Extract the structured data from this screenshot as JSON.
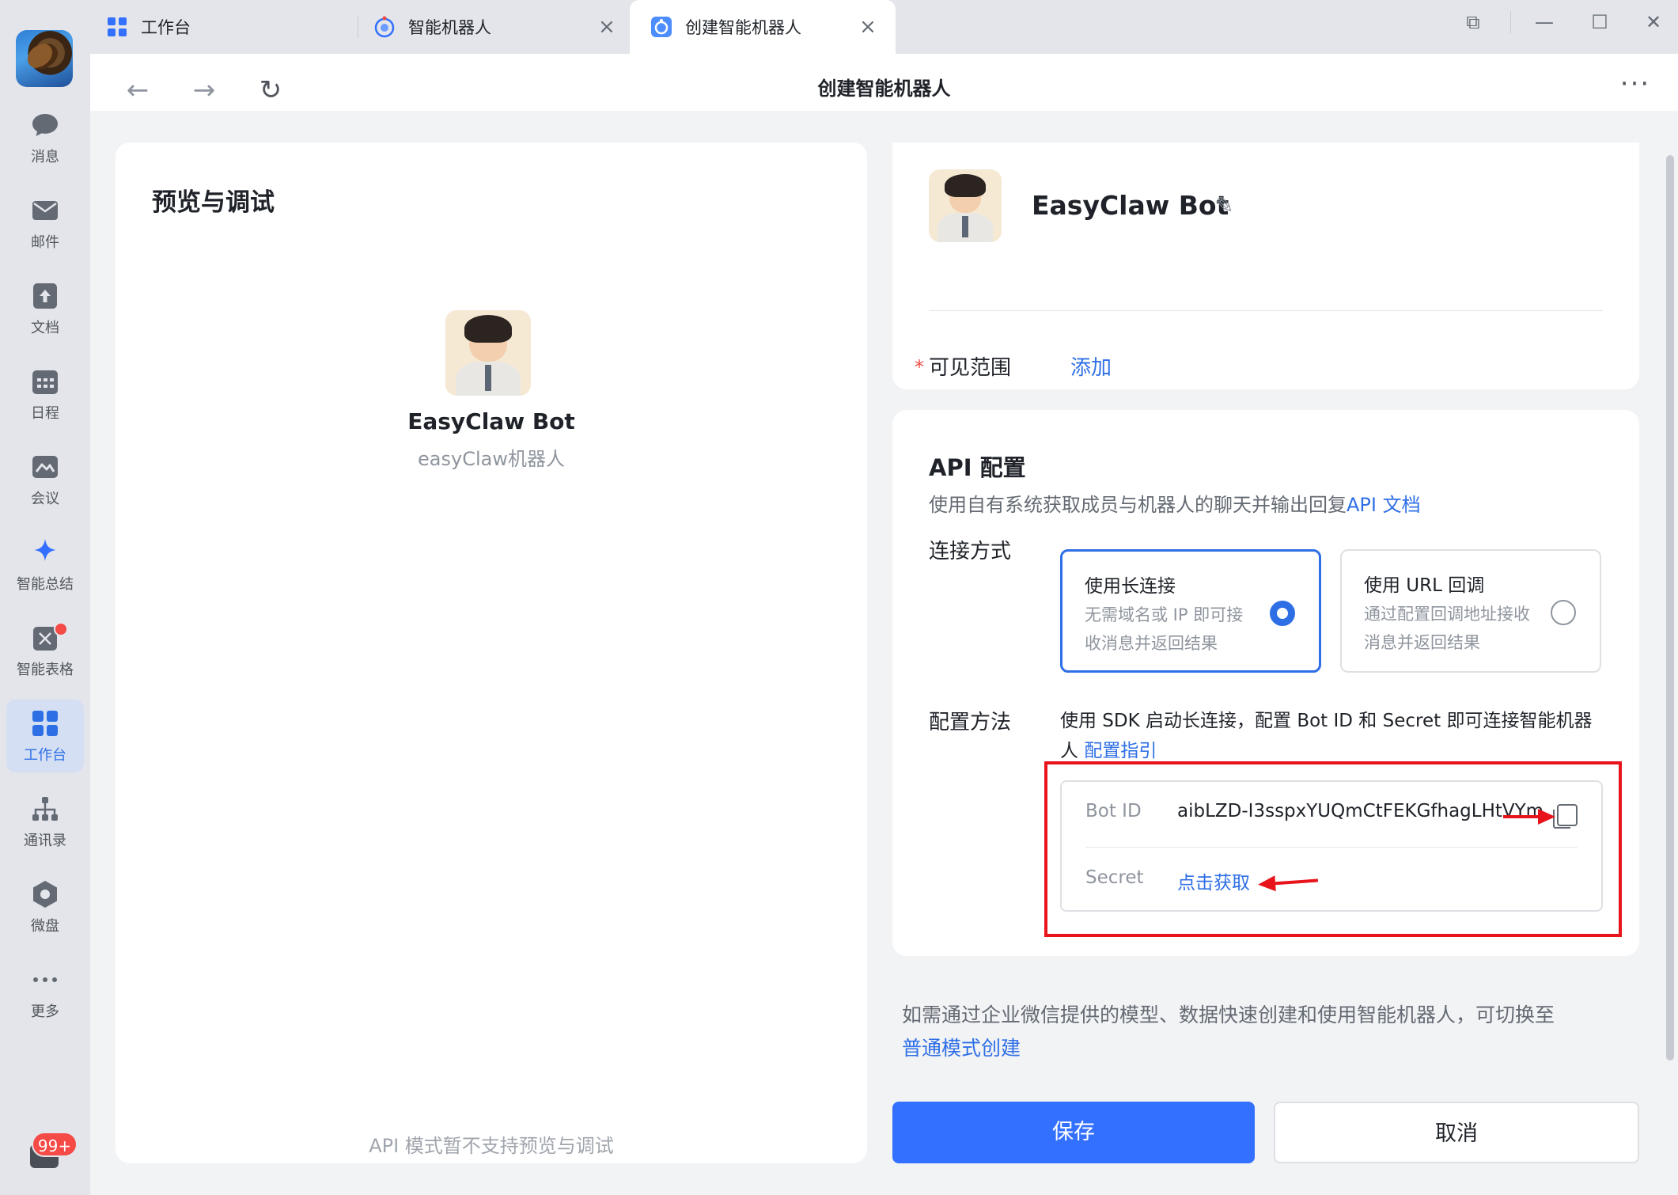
{
  "colors": {
    "accent": "#3370ff",
    "link": "#2f6fe6",
    "annotation": "#e8141c",
    "badge": "#f54a45"
  },
  "nav": {
    "items": [
      {
        "label": "消息",
        "icon": "chat-bubble-icon"
      },
      {
        "label": "邮件",
        "icon": "mail-icon"
      },
      {
        "label": "文档",
        "icon": "document-icon"
      },
      {
        "label": "日程",
        "icon": "calendar-icon"
      },
      {
        "label": "会议",
        "icon": "meeting-icon"
      },
      {
        "label": "智能总结",
        "icon": "sparkle-icon"
      },
      {
        "label": "智能表格",
        "icon": "smart-table-icon"
      },
      {
        "label": "工作台",
        "icon": "grid-apps-icon"
      },
      {
        "label": "通讯录",
        "icon": "org-chart-icon"
      },
      {
        "label": "微盘",
        "icon": "cloud-drive-icon"
      },
      {
        "label": "更多",
        "icon": "more-dots-icon"
      }
    ],
    "active": "工作台",
    "unread_badge": "99+"
  },
  "tabs": [
    {
      "label": "工作台",
      "icon": "grid-apps-icon"
    },
    {
      "label": "智能机器人",
      "icon": "robot-icon",
      "close": "×"
    },
    {
      "label": "创建智能机器人",
      "icon": "robot-icon",
      "close": "×"
    }
  ],
  "window": {
    "restore": "⧉",
    "minimize": "—",
    "maximize": "☐",
    "close": "✕"
  },
  "toolbar": {
    "back": "←",
    "forward": "→",
    "refresh": "↻",
    "title": "创建智能机器人",
    "more": "···"
  },
  "preview": {
    "heading": "预览与调试",
    "bot_name": "EasyClaw Bot",
    "bot_sub": "easyClaw机器人",
    "note": "API 模式暂不支持预览与调试"
  },
  "info": {
    "bot_name": "EasyClaw Bot",
    "edit_icon": "✎",
    "required_mark": "*",
    "visibility_label": "可见范围",
    "add_label": "添加"
  },
  "api": {
    "heading": "API 配置",
    "desc": "使用自有系统获取成员与机器人的聊天并输出回复",
    "doc_link": "API 文档",
    "connection_label": "连接方式",
    "options": [
      {
        "title": "使用长连接",
        "desc": "无需域名或 IP 即可接收消息并返回结果",
        "selected": true
      },
      {
        "title": "使用 URL 回调",
        "desc": "通过配置回调地址接收消息并返回结果",
        "selected": false
      }
    ],
    "method_label": "配置方法",
    "method_text": "使用 SDK 启动长连接，配置 Bot ID 和 Secret 即可连接智能机器人",
    "method_link": "配置指引",
    "bot_id_label": "Bot ID",
    "bot_id_value": "aibLZD-I3sspxYUQmCtFEKGfhagLHtVYm",
    "secret_label": "Secret",
    "secret_link": "点击获取"
  },
  "footer": {
    "note": "如需通过企业微信提供的模型、数据快速创建和使用智能机器人，可切换至",
    "switch_link": "普通模式创建",
    "save": "保存",
    "cancel": "取消"
  }
}
